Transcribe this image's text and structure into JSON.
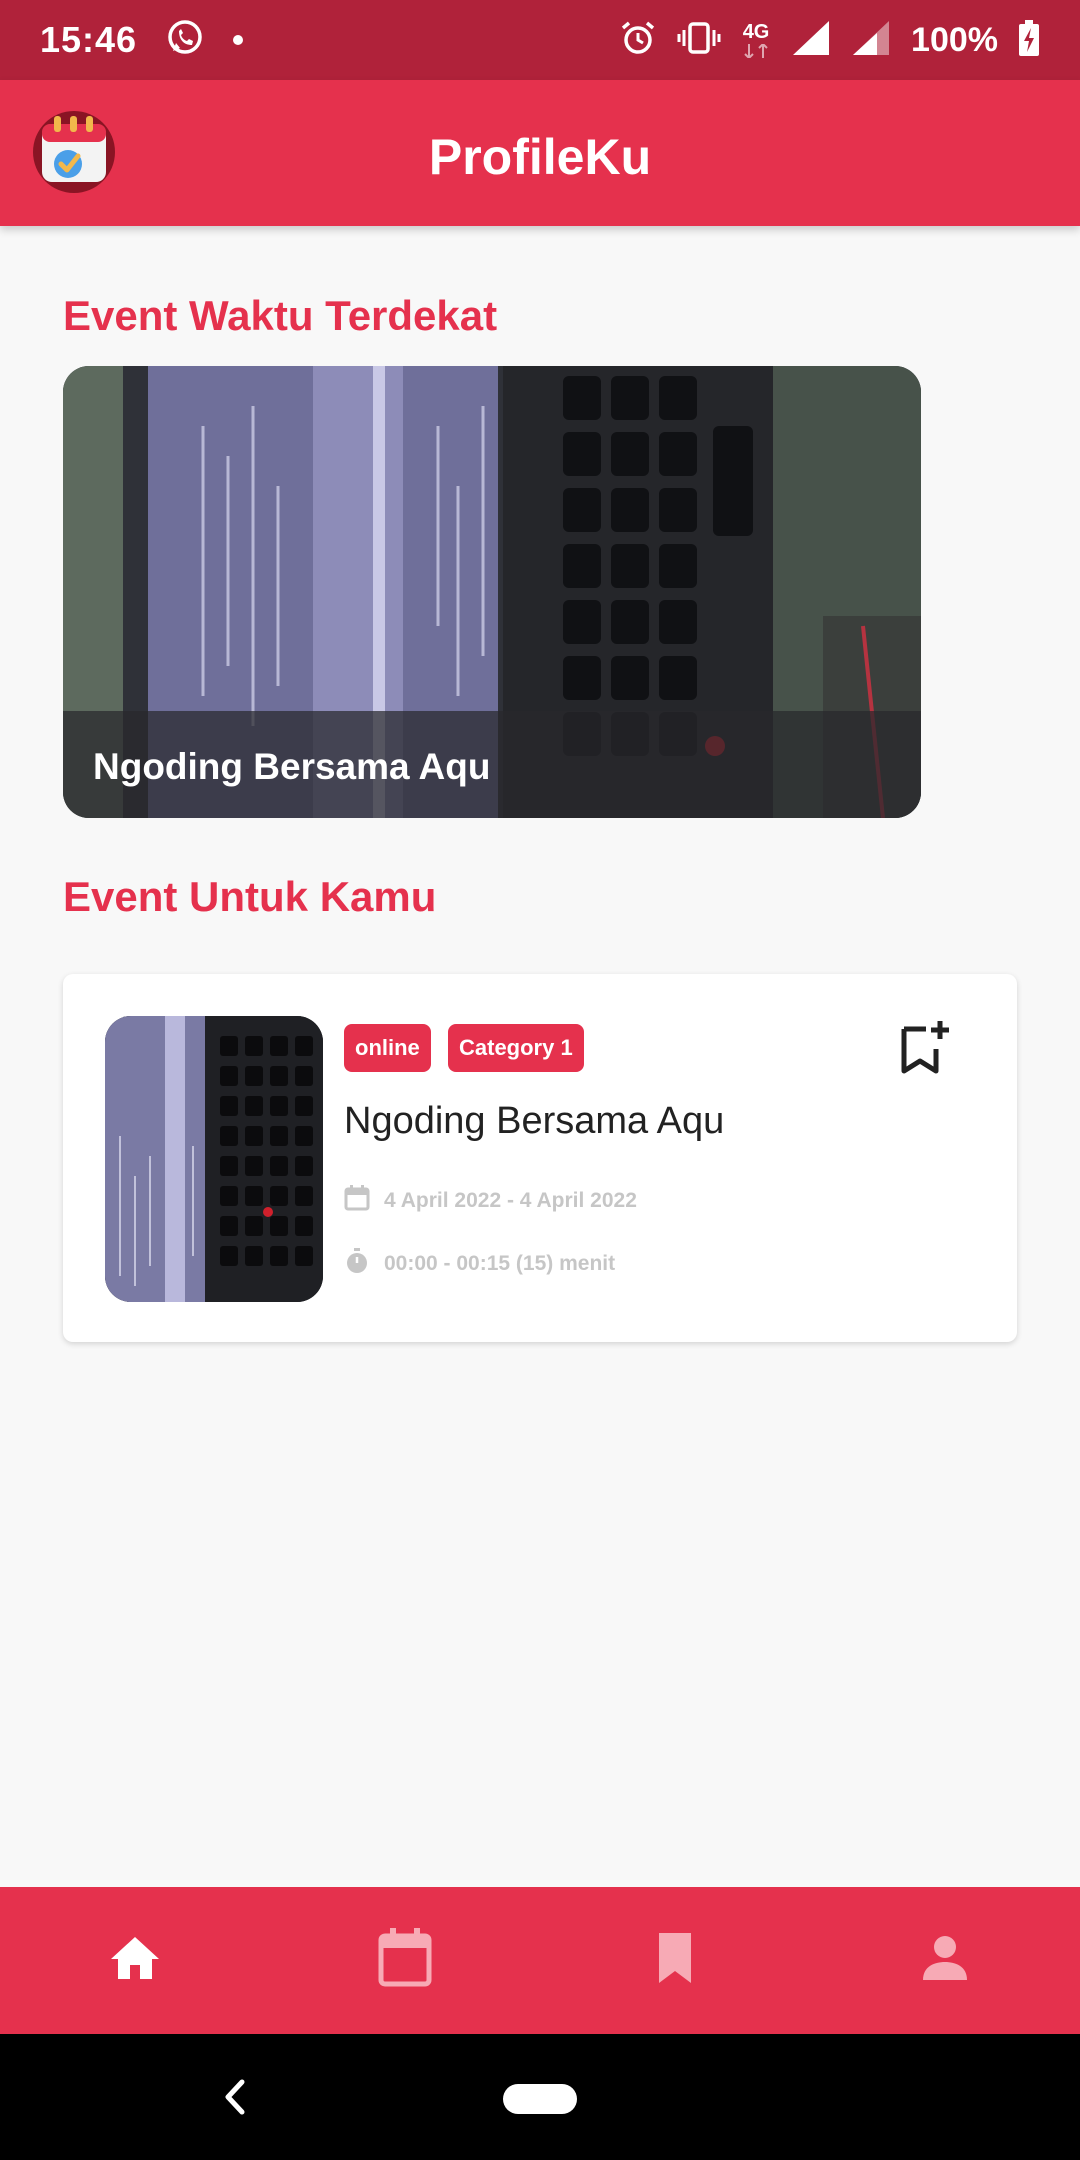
{
  "status_bar": {
    "time": "15:46",
    "network_label": "4G",
    "battery": "100%",
    "icons": [
      "whatsapp-icon",
      "alarm-icon",
      "vibrate-icon",
      "signal-icon",
      "battery-charging-icon"
    ]
  },
  "app_bar": {
    "title": "ProfileKu",
    "logo_icon": "calendar-check-icon"
  },
  "sections": {
    "nearest_title": "Event Waktu Terdekat",
    "for_you_title": "Event Untuk Kamu"
  },
  "featured_event": {
    "title": "Ngoding Bersama Aqu"
  },
  "event_card": {
    "tags": [
      "online",
      "Category 1"
    ],
    "title": "Ngoding Bersama Aqu",
    "date": "4 April 2022 - 4 April 2022",
    "time": "00:00 - 00:15 (15) menit",
    "bookmark_icon": "bookmark-add-icon"
  },
  "bottom_nav": {
    "items": [
      "home-icon",
      "calendar-icon",
      "bookmark-icon",
      "person-icon"
    ],
    "active": "home-icon"
  },
  "colors": {
    "primary": "#e5314d",
    "status_bar": "#b0223a",
    "background": "#f8f8f8",
    "meta_text": "#c6c6c6"
  }
}
